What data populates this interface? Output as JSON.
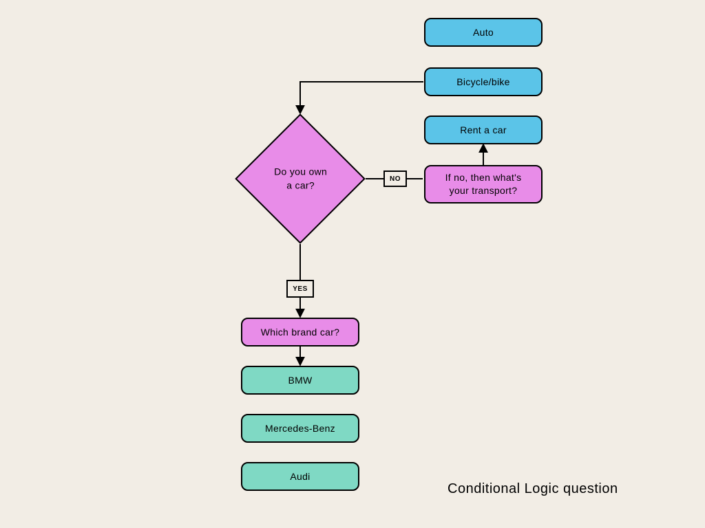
{
  "title": "Conditional Logic question",
  "nodes": {
    "auto": "Auto",
    "bikebike": "Bicycle/bike",
    "own_car": "Do you own\na car?",
    "rent_car": "Rent a car",
    "if_no": "If no, then what's\nyour transport?",
    "which_brand": "Which brand car?",
    "bmw": "BMW",
    "mercedes": "Mercedes-Benz",
    "audi": "Audi"
  },
  "labels": {
    "no": "NO",
    "yes": "YES"
  }
}
